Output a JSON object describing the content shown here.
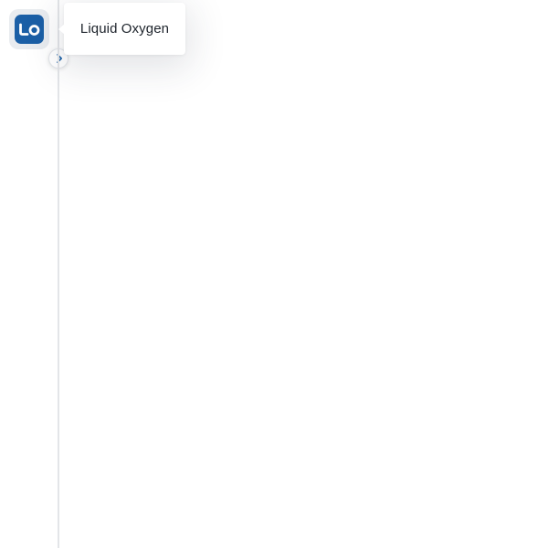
{
  "sidebar": {
    "logo": {
      "icon": "liquid-oxygen-logo-icon",
      "color": "#1b5fa6"
    },
    "toggle": {
      "icon": "chevron-right-icon",
      "color": "#1b5fa6"
    }
  },
  "tooltip": {
    "text": "Liquid Oxygen"
  }
}
